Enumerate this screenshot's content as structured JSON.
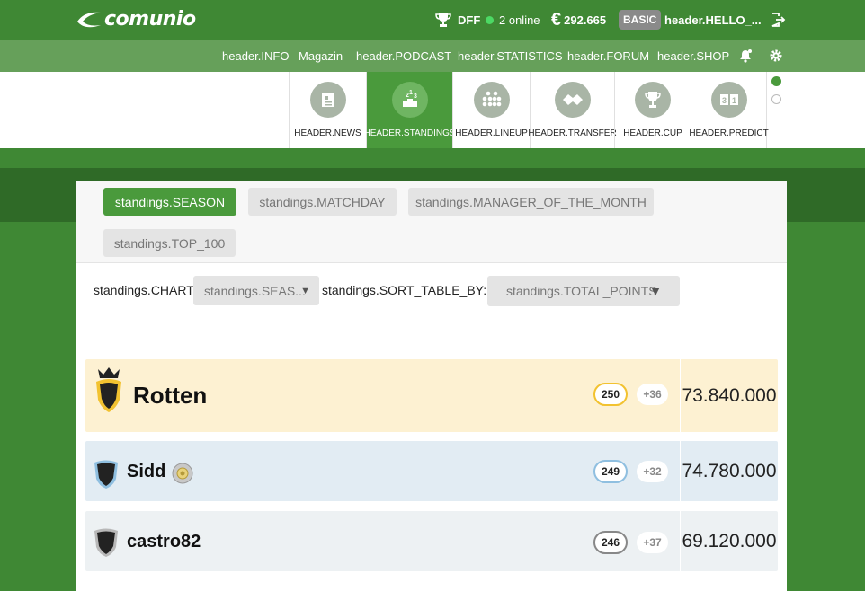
{
  "header": {
    "logo_text": "comunio",
    "trophy_label": "DFF",
    "online_text": "2 online",
    "currency_symbol": "€",
    "budget": "292.665",
    "plan_badge": "BASIC",
    "greeting": "header.HELLO_...",
    "icons": [
      "logo-swoosh-icon",
      "trophy-icon",
      "online-dot-icon",
      "euro-icon",
      "logout-icon"
    ]
  },
  "subnav": {
    "items": [
      "header.INFO",
      "Magazin",
      "header.PODCAST",
      "header.STATISTICS",
      "header.FORUM",
      "header.SHOP"
    ],
    "icons": [
      "notifications-icon",
      "gear-icon"
    ]
  },
  "features": [
    {
      "label": "HEADER.NEWS",
      "icon": "news-icon",
      "active": false
    },
    {
      "label": "HEADER.STANDINGS",
      "icon": "podium-icon",
      "active": true
    },
    {
      "label": "HEADER.LINEUP",
      "icon": "lineup-icon",
      "active": false
    },
    {
      "label": "HEADER.TRANSFER",
      "icon": "transfer-icon",
      "active": false
    },
    {
      "label": "HEADER.CUP",
      "icon": "cup-icon",
      "active": false
    },
    {
      "label": "HEADER.PREDICT",
      "icon": "predict-icon",
      "active": false
    }
  ],
  "tabs": [
    "standings.SEASON",
    "standings.MATCHDAY",
    "standings.MANAGER_OF_THE_MONTH",
    "standings.TOP_100"
  ],
  "active_tab": "standings.SEASON",
  "filters": {
    "chart_label": "standings.CHART:",
    "chart_value": "standings.SEAS...",
    "sort_label": "standings.SORT_TABLE_BY:",
    "sort_value": "standings.TOTAL_POINTS"
  },
  "standings": [
    {
      "name": "Rotten",
      "points": "250",
      "diff": "+36",
      "value": "73.840.000",
      "shield": "gold-crown"
    },
    {
      "name": "Sidd",
      "points": "249",
      "diff": "+32",
      "value": "74.780.000",
      "shield": "silver",
      "badge_icon": "medal-icon"
    },
    {
      "name": "castro82",
      "points": "246",
      "diff": "+37",
      "value": "69.120.000",
      "shield": "bronze"
    }
  ],
  "colors": {
    "brand_green": "#3f8834",
    "active_green": "#4a9a3c",
    "first_row_bg": "#fdf1d2",
    "second_row_bg": "#e2ecf3",
    "third_row_bg": "#edf1f3",
    "gold": "#f2c230",
    "silver_blue": "#8fbfe0"
  }
}
